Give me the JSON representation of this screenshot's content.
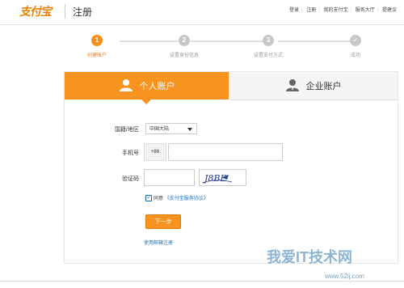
{
  "header": {
    "logo_text": "支付宝",
    "title": "注册",
    "nav": [
      "登录",
      "注册",
      "我的支付宝",
      "服务大厅",
      "提建议"
    ]
  },
  "steps": [
    {
      "num": "1",
      "label": "创建账户",
      "active": true
    },
    {
      "num": "2",
      "label": "设置身份信息",
      "active": false
    },
    {
      "num": "3",
      "label": "设置支付方式",
      "active": false
    },
    {
      "num": "✓",
      "label": "成功",
      "active": false
    }
  ],
  "tabs": {
    "personal": "个人账户",
    "business": "企业账户"
  },
  "form": {
    "region_label": "国籍/地区",
    "region_value": "中国大陆",
    "phone_label": "手机号",
    "phone_prefix": "+86",
    "phone_value": "",
    "captcha_label": "验证码",
    "captcha_value": "",
    "captcha_image_text": "J8BE",
    "agree_prefix": "同意",
    "agree_link": "《支付宝服务协议》",
    "next_label": "下一步",
    "email_register": "使用邮箱注册"
  },
  "watermark": {
    "main": "我爱IT技术网",
    "sub": "www.52ij.com"
  },
  "colors": {
    "accent": "#f7931e",
    "link": "#1b6fb8"
  }
}
